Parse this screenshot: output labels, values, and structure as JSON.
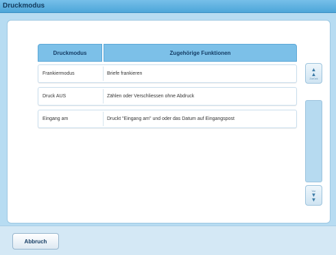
{
  "window": {
    "title": "Druckmodus"
  },
  "table": {
    "headers": [
      "Druckmodus",
      "Zugehörige Funktionen"
    ],
    "rows": [
      {
        "mode": "Frankiermodus",
        "function": "Briefe frankieren"
      },
      {
        "mode": "Druck AUS",
        "function": "Zählen oder Verschliessen ohne Abdruck"
      },
      {
        "mode": "Eingang am",
        "function": "Druckt \"Eingang am\" und oder das Datum auf Eingangspost"
      }
    ]
  },
  "scroll": {
    "up_label": "Zurück",
    "down_label": "Vor"
  },
  "footer": {
    "cancel_label": "Abbruch"
  }
}
